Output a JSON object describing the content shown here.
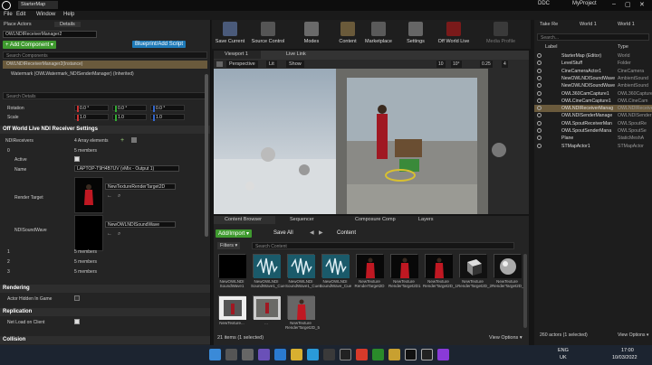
{
  "window": {
    "title": "StarterMap",
    "tabs": [
      "DDC",
      "MyProject"
    ],
    "controls": [
      "–",
      "▢",
      "✕"
    ]
  },
  "menu": [
    "File",
    "Edit",
    "Window",
    "Help"
  ],
  "left": {
    "tabs": [
      "Place Actors",
      "Details"
    ],
    "actor_name": "OWLNDIReceiverManager2",
    "add_component": "+ Add Component ▾",
    "blueprint": "Blueprint/Add Script",
    "search_components": "Search Components",
    "components": [
      "OWLNDIReceiverManager2(Instance)",
      "Watermark (OWLWatermark_NDISenderManager) (Inherited)"
    ],
    "search_details": "Search Details",
    "rotation": {
      "label": "Rotation",
      "x": "0.0 °",
      "y": "0.0 °",
      "z": "0.0 °"
    },
    "scale": {
      "label": "Scale",
      "x": "1.0",
      "y": "1.0",
      "z": "1.0"
    },
    "section_ndi": "Off World Live NDI Receiver Settings",
    "ndi_receivers": {
      "label": "NDIReceivers",
      "value": "4 Array elements"
    },
    "item0": {
      "index": "0",
      "value": "5 members"
    },
    "active": "Active",
    "name": {
      "label": "Name",
      "value": "LAPTOP-T9H4B7UV (vMix - Output 1)"
    },
    "render_target": {
      "label": "Render Target",
      "value": "NewTextureRenderTarget2D"
    },
    "sound_wave": {
      "label": "NDISoundWave",
      "value": "NewOWLNDISoundWave"
    },
    "members": [
      {
        "index": "1",
        "value": "5 members"
      },
      {
        "index": "2",
        "value": "5 members"
      },
      {
        "index": "3",
        "value": "5 members"
      }
    ],
    "section_rendering": "Rendering",
    "hidden": "Actor Hidden In Game",
    "section_replication": "Replication",
    "net_load": "Net Load on Client",
    "section_collision": "Collision"
  },
  "toolbar": [
    "Save Current",
    "Source Control",
    "Modes",
    "Content",
    "Marketplace",
    "Settings",
    "Off World Live",
    "Media Profile"
  ],
  "viewport": {
    "tabs": [
      "Viewport 1",
      "Live Link"
    ],
    "perspective": "Perspective",
    "lit": "Lit",
    "show": "Show",
    "grid": "10",
    "angle": "10°",
    "scale": "0.25",
    "speed": "4"
  },
  "content": {
    "tabs": [
      "Content Browser",
      "Sequencer",
      "Composure Comp",
      "Layers"
    ],
    "add_import": "Add/Import ▾",
    "save_all": "Save All",
    "path": "Content",
    "filters": "Filters ▾",
    "search": "Search Content",
    "assets": [
      {
        "label": "NewOWLNDI SoundWave1",
        "kind": "black"
      },
      {
        "label": "NewOWLNDI SoundWave1_Cue",
        "kind": "wave"
      },
      {
        "label": "NewOWLNDI SoundWave1_Cue1",
        "kind": "wave"
      },
      {
        "label": "NewOWLNDI SoundWave_Cue",
        "kind": "wave"
      },
      {
        "label": "NewTexture RenderTarget2D",
        "kind": "red"
      },
      {
        "label": "NewTexture RenderTarget2D1",
        "kind": "red"
      },
      {
        "label": "NewTexture RenderTarget2D_1",
        "kind": "red"
      },
      {
        "label": "NewTexture RenderTarget2D_2",
        "kind": "cube"
      },
      {
        "label": "NewTexture RenderTarget2D_3",
        "kind": "sphere"
      },
      {
        "label": "NewTexture...",
        "kind": "room"
      },
      {
        "label": "...",
        "kind": "room2"
      },
      {
        "label": "NewTexture RenderTarget2D_5",
        "kind": "red2"
      }
    ],
    "status": "21 items (1 selected)",
    "view_options": "View Options ▾"
  },
  "outliner": {
    "tabs": [
      "Take Re",
      "World 1",
      "World 1"
    ],
    "search": "Search...",
    "col_label": "Label",
    "col_type": "Type",
    "rows": [
      {
        "name": "StarterMap (Editor)",
        "type": "World",
        "sel": false
      },
      {
        "name": "LevelStuff",
        "type": "Folder",
        "sel": false
      },
      {
        "name": "CineCameraActor1",
        "type": "CineCamera",
        "sel": false
      },
      {
        "name": "NewOWLNDISoundWave",
        "type": "AmbientSound",
        "sel": false
      },
      {
        "name": "NewOWLNDISoundWave",
        "type": "AmbientSound",
        "sel": false
      },
      {
        "name": "OWL360CamCapture1",
        "type": "OWL360Capture",
        "sel": false
      },
      {
        "name": "OWLCineCamCapture1",
        "type": "OWLCineCam",
        "sel": false
      },
      {
        "name": "OWLNDIReceiverManag",
        "type": "OWLNDIReceiver",
        "sel": true
      },
      {
        "name": "OWLNDISenderManage",
        "type": "OWLNDISender",
        "sel": false
      },
      {
        "name": "OWLSpoutReceiverMan",
        "type": "OWLSpoutRe",
        "sel": false
      },
      {
        "name": "OWLSpoutSenderMana",
        "type": "OWLSpoutSe",
        "sel": false
      },
      {
        "name": "Plane",
        "type": "StaticMeshA",
        "sel": false
      },
      {
        "name": "STMapActor1",
        "type": "STMapActor",
        "sel": false
      }
    ],
    "status": "260 actors (1 selected)",
    "view_options": "View Options ▾"
  },
  "taskbar": {
    "lang": "ENG",
    "region": "UK",
    "time": "17:00",
    "date": "10/03/2022"
  }
}
